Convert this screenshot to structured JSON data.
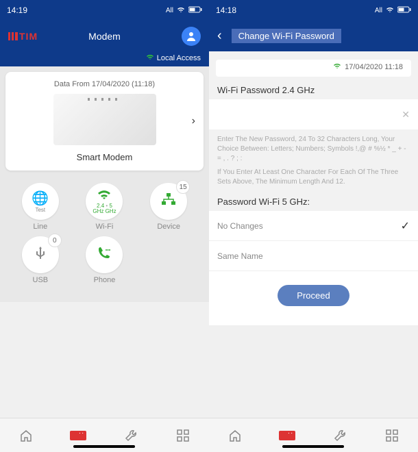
{
  "left": {
    "status_time": "14:19",
    "status_label": "All",
    "brand": "TIM",
    "nav_title": "Modem",
    "local_access": "Local Access",
    "card_data_from": "Data From 17/04/2020 (11:18)",
    "card_name": "Smart Modem",
    "grid": {
      "line": {
        "sub": "Test",
        "label": "Line"
      },
      "wifi": {
        "band1": "2.4",
        "band2": "5",
        "bandunit": "GHz GHz",
        "label": "Wi-Fi"
      },
      "device": {
        "badge": "15",
        "label": "Device"
      },
      "usb": {
        "badge": "0",
        "label": "USB"
      },
      "phone": {
        "label": "Phone"
      }
    }
  },
  "right": {
    "status_time": "14:18",
    "status_label": "All",
    "nav_title": "Change Wi-Fi Password",
    "timestamp": "17/04/2020 11:18",
    "section24": "Wi-Fi Password 2.4 GHz",
    "hint1": "Enter The New Password, 24 To 32 Characters Long, Your Choice Between: Letters; Numbers; Symbols !,@ # %½ * _ + - = , . ? ; :",
    "hint2": "If You Enter At Least One Character For Each Of The Three Sets Above, The Minimum Length And 12.",
    "section5": "Password Wi-Fi 5 GHz:",
    "nochanges": "No Changes",
    "samename": "Same Name",
    "proceed": "Proceed"
  }
}
